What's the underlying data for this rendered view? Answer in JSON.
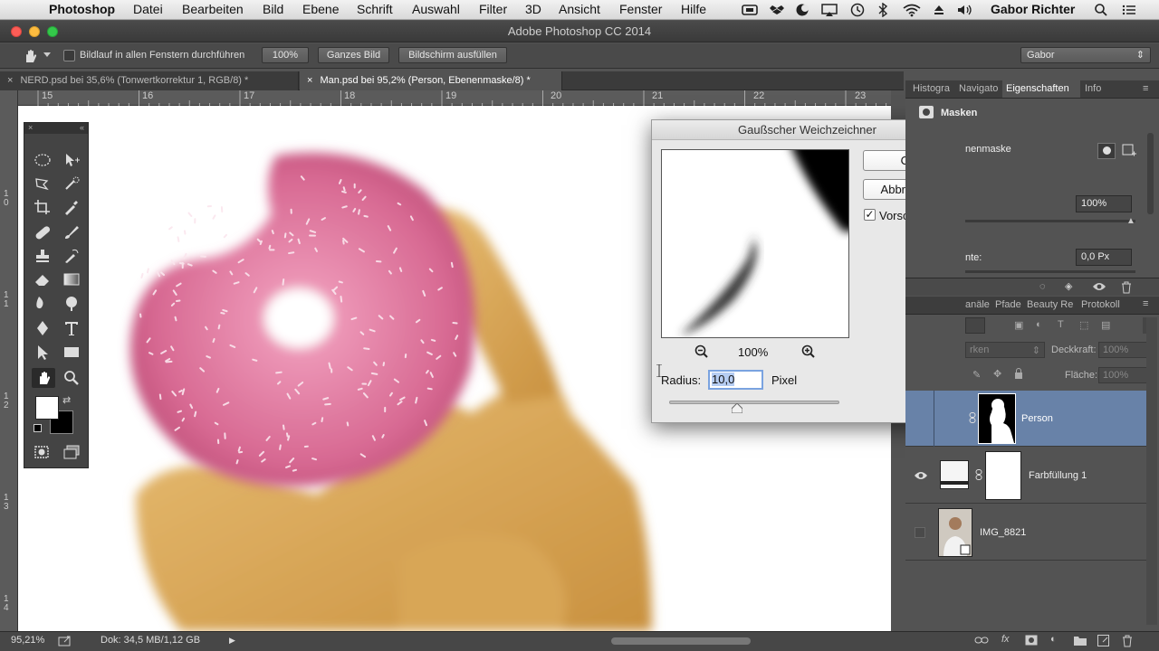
{
  "menubar": {
    "apple": "",
    "items": [
      "Photoshop",
      "Datei",
      "Bearbeiten",
      "Bild",
      "Ebene",
      "Schrift",
      "Auswahl",
      "Filter",
      "3D",
      "Ansicht",
      "Fenster",
      "Hilfe"
    ],
    "user": "Gabor Richter"
  },
  "window": {
    "title": "Adobe Photoshop CC 2014"
  },
  "options": {
    "scroll_all_label": "Bildlauf in allen Fenstern durchführen",
    "zoom_btn": "100%",
    "fit_btn": "Ganzes Bild",
    "fill_btn": "Bildschirm ausfüllen",
    "workspace": "Gabor"
  },
  "tabs": [
    {
      "label": "NERD.psd bei 35,6% (Tonwertkorrektur 1, RGB/8) *",
      "active": false
    },
    {
      "label": "Man.psd bei 95,2% (Person, Ebenenmaske/8) *",
      "active": true
    }
  ],
  "ruler_h": [
    "15",
    "16",
    "17",
    "18",
    "19",
    "20",
    "21",
    "22",
    "23"
  ],
  "ruler_v": [
    "1\n0",
    "1\n1",
    "1\n2",
    "1\n3",
    "1\n4"
  ],
  "dialog": {
    "title": "Gaußscher Weichzeichner",
    "ok": "OK",
    "cancel": "Abbrechen",
    "preview_label": "Vorschau",
    "preview_checked": true,
    "zoom": "100%",
    "radius_label": "Radius:",
    "radius_value": "10,0",
    "unit": "Pixel",
    "slider_value": 0.4
  },
  "props": {
    "tabs": [
      "Histogra",
      "Navigato",
      "Eigenschaften",
      "Info"
    ],
    "section": "Masken",
    "mask_type": "nenmaske",
    "density": "100%",
    "feather_label": "nte:",
    "feather_value": "0,0 Px"
  },
  "layers_panel": {
    "tabs": [
      "anäle",
      "Pfade",
      "Beauty Re",
      "Protokoll"
    ],
    "blend": "rken",
    "opacity_label": "Deckkraft:",
    "opacity": "100%",
    "fill_label": "Fläche:",
    "fill": "100%",
    "layers": [
      {
        "name": "Person",
        "selected": true,
        "visible": false
      },
      {
        "name": "Farbfüllung 1",
        "selected": false,
        "visible": true
      },
      {
        "name": "IMG_8821",
        "selected": false,
        "visible": false
      }
    ]
  },
  "status": {
    "zoom": "95,21%",
    "doc": "Dok: 34,5 MB/1,12 GB"
  },
  "colors": {
    "accent": "#3b7bd6",
    "selected_layer": "#6882a8",
    "panel": "#535353"
  }
}
